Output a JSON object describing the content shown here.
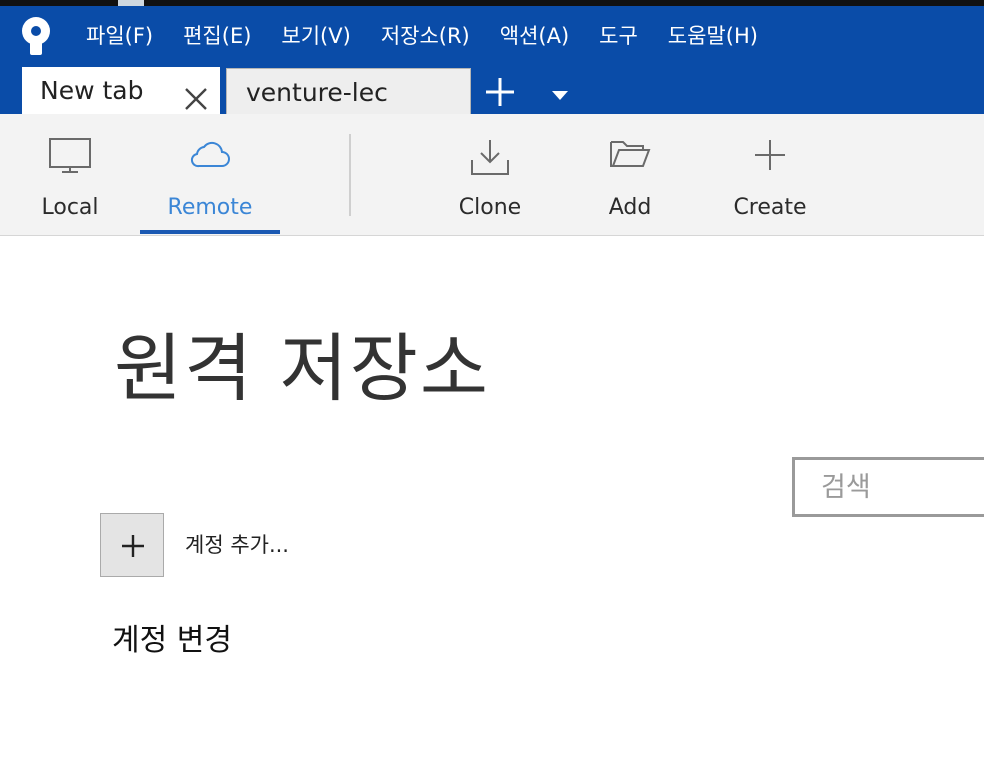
{
  "menu": {
    "items": [
      "파일(F)",
      "편집(E)",
      "보기(V)",
      "저장소(R)",
      "액션(A)",
      "도구",
      "도움말(H)"
    ]
  },
  "tabs": {
    "active_label": "New tab",
    "inactive_label": "venture-lec"
  },
  "toolbar": {
    "local_label": "Local",
    "remote_label": "Remote",
    "clone_label": "Clone",
    "add_label": "Add",
    "create_label": "Create",
    "active": "Remote"
  },
  "main": {
    "title": "원격 저장소",
    "search_placeholder": "검색",
    "add_account_label": "계정 추가...",
    "change_account_label": "계정 변경"
  },
  "colors": {
    "titlebar": "#0a4ca8",
    "accent": "#3b86d6",
    "underline": "#1b59b3"
  }
}
